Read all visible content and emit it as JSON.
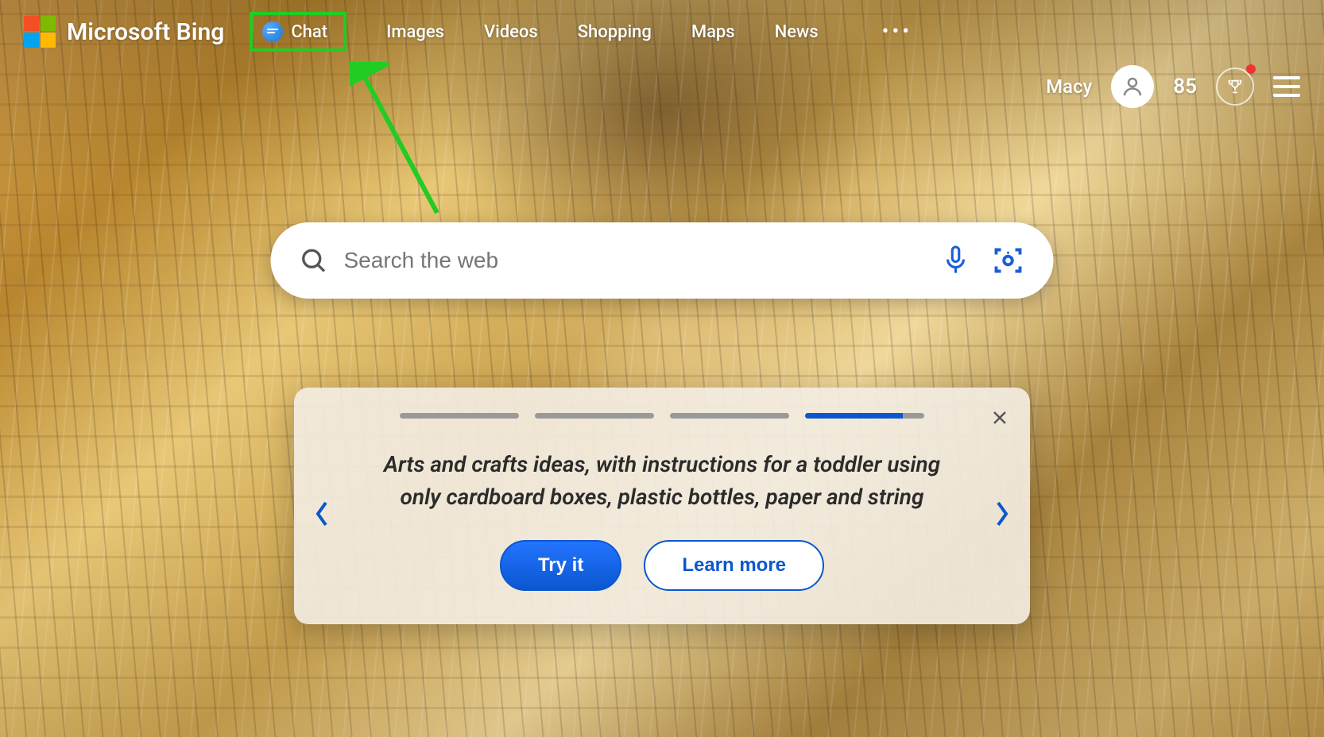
{
  "brand": "Microsoft Bing",
  "nav": {
    "chat": "Chat",
    "images": "Images",
    "videos": "Videos",
    "shopping": "Shopping",
    "maps": "Maps",
    "news": "News"
  },
  "user": {
    "name": "Macy",
    "points": "85"
  },
  "search": {
    "placeholder": "Search the web"
  },
  "promo": {
    "text": "Arts and crafts ideas, with instructions for a toddler using only cardboard boxes, plastic bottles, paper and string",
    "try_label": "Try it",
    "learn_label": "Learn more",
    "active_index": 3,
    "total": 4
  },
  "colors": {
    "accent": "#0b57d0",
    "highlight": "#22cc22"
  }
}
